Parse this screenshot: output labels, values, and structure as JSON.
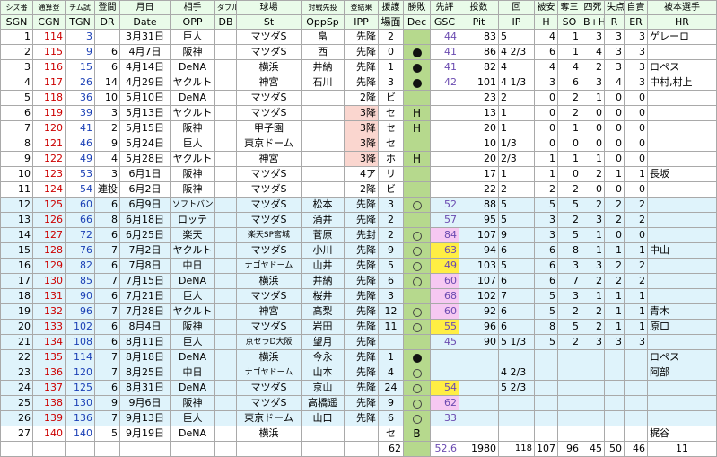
{
  "headers_top": [
    "シズ番",
    "通算登",
    "チム試",
    "登間",
    "月日",
    "相手",
    "ダブル",
    "球場",
    "対戦先投",
    "登結果",
    "援護",
    "勝敗",
    "先評",
    "投数",
    "回",
    "被安",
    "奪三",
    "四死",
    "失点",
    "自責",
    "被本選手"
  ],
  "headers": [
    "SGN",
    "CGN",
    "TGN",
    "DR",
    "Date",
    "OPP",
    "DB",
    "St",
    "OppSp",
    "IPP",
    "場面",
    "Dec",
    "GSC",
    "Pit",
    "IP",
    "H",
    "SO",
    "B+H",
    "R",
    "ER",
    "HR"
  ],
  "rows": [
    {
      "sgn": "1",
      "cgn": "114",
      "tgn": "3",
      "dr": "",
      "date": "3月31日",
      "opp": "巨人",
      "db": "",
      "st": "マツダS",
      "oppsp": "畠",
      "ipp": "先降",
      "sup": "2",
      "dec": "",
      "gsc": "44",
      "pit": "83",
      "ip": "5",
      "h": "4",
      "so": "1",
      "bh": "3",
      "r": "3",
      "er": "3",
      "hr": "ゲレーロ",
      "bg": "white",
      "decType": "none",
      "gscColor": "",
      "resPink": false
    },
    {
      "sgn": "2",
      "cgn": "115",
      "tgn": "9",
      "dr": "6",
      "date": "4月7日",
      "opp": "阪神",
      "db": "",
      "st": "マツダS",
      "oppsp": "西",
      "ipp": "先降",
      "sup": "0",
      "dec": "●",
      "gsc": "41",
      "pit": "86",
      "ip": "4 2/3",
      "h": "6",
      "so": "1",
      "bh": "4",
      "r": "3",
      "er": "3",
      "hr": "",
      "bg": "white",
      "decType": "filled",
      "gscColor": "",
      "resPink": false
    },
    {
      "sgn": "3",
      "cgn": "116",
      "tgn": "15",
      "dr": "6",
      "date": "4月14日",
      "opp": "DeNA",
      "db": "",
      "st": "横浜",
      "oppsp": "井納",
      "ipp": "先降",
      "sup": "1",
      "dec": "●",
      "gsc": "41",
      "pit": "82",
      "ip": "4",
      "h": "4",
      "so": "4",
      "bh": "2",
      "r": "3",
      "er": "3",
      "hr": "ロペス",
      "bg": "white",
      "decType": "filled",
      "gscColor": "",
      "resPink": false
    },
    {
      "sgn": "4",
      "cgn": "117",
      "tgn": "26",
      "dr": "14",
      "date": "4月29日",
      "opp": "ヤクルト",
      "db": "",
      "st": "神宮",
      "oppsp": "石川",
      "ipp": "先降",
      "sup": "3",
      "dec": "●",
      "gsc": "42",
      "pit": "101",
      "ip": "4 1/3",
      "h": "3",
      "so": "6",
      "bh": "3",
      "r": "4",
      "er": "3",
      "hr": "中村,村上",
      "bg": "white",
      "decType": "filled",
      "gscColor": "",
      "resPink": false
    },
    {
      "sgn": "5",
      "cgn": "118",
      "tgn": "36",
      "dr": "10",
      "date": "5月10日",
      "opp": "DeNA",
      "db": "",
      "st": "マツダS",
      "oppsp": "",
      "ipp": "2降",
      "sup": "ビ",
      "dec": "",
      "gsc": "",
      "pit": "23",
      "ip": "2",
      "h": "0",
      "so": "2",
      "bh": "1",
      "r": "0",
      "er": "0",
      "hr": "",
      "bg": "white",
      "decType": "none",
      "gscColor": "",
      "resPink": false
    },
    {
      "sgn": "6",
      "cgn": "119",
      "tgn": "39",
      "dr": "3",
      "date": "5月13日",
      "opp": "ヤクルト",
      "db": "",
      "st": "マツダS",
      "oppsp": "",
      "ipp": "3降",
      "sup": "セ",
      "dec": "H",
      "gsc": "",
      "pit": "13",
      "ip": "1",
      "h": "0",
      "so": "2",
      "bh": "0",
      "r": "0",
      "er": "0",
      "hr": "",
      "bg": "white",
      "decType": "text",
      "gscColor": "",
      "resPink": true
    },
    {
      "sgn": "7",
      "cgn": "120",
      "tgn": "41",
      "dr": "2",
      "date": "5月15日",
      "opp": "阪神",
      "db": "",
      "st": "甲子園",
      "oppsp": "",
      "ipp": "3降",
      "sup": "セ",
      "dec": "H",
      "gsc": "",
      "pit": "20",
      "ip": "1",
      "h": "0",
      "so": "1",
      "bh": "0",
      "r": "0",
      "er": "0",
      "hr": "",
      "bg": "white",
      "decType": "text",
      "gscColor": "",
      "resPink": true
    },
    {
      "sgn": "8",
      "cgn": "121",
      "tgn": "46",
      "dr": "9",
      "date": "5月24日",
      "opp": "巨人",
      "db": "",
      "st": "東京ドーム",
      "oppsp": "",
      "ipp": "3降",
      "sup": "セ",
      "dec": "",
      "gsc": "",
      "pit": "10",
      "ip": "1/3",
      "h": "0",
      "so": "0",
      "bh": "0",
      "r": "0",
      "er": "0",
      "hr": "",
      "bg": "white",
      "decType": "none",
      "gscColor": "",
      "resPink": true
    },
    {
      "sgn": "9",
      "cgn": "122",
      "tgn": "49",
      "dr": "4",
      "date": "5月28日",
      "opp": "ヤクルト",
      "db": "",
      "st": "神宮",
      "oppsp": "",
      "ipp": "3降",
      "sup": "ホ",
      "dec": "H",
      "gsc": "",
      "pit": "20",
      "ip": "2/3",
      "h": "1",
      "so": "1",
      "bh": "1",
      "r": "0",
      "er": "0",
      "hr": "",
      "bg": "white",
      "decType": "text",
      "gscColor": "",
      "resPink": true
    },
    {
      "sgn": "10",
      "cgn": "123",
      "tgn": "53",
      "dr": "3",
      "date": "6月1日",
      "opp": "阪神",
      "db": "",
      "st": "マツダS",
      "oppsp": "",
      "ipp": "4ア",
      "sup": "リ",
      "dec": "",
      "gsc": "",
      "pit": "17",
      "ip": "1",
      "h": "1",
      "so": "0",
      "bh": "2",
      "r": "1",
      "er": "1",
      "hr": "長坂",
      "bg": "white",
      "decType": "none",
      "gscColor": "",
      "resPink": false
    },
    {
      "sgn": "11",
      "cgn": "124",
      "tgn": "54",
      "dr": "連投",
      "date": "6月2日",
      "opp": "阪神",
      "db": "",
      "st": "マツダS",
      "oppsp": "",
      "ipp": "2降",
      "sup": "ビ",
      "dec": "",
      "gsc": "",
      "pit": "22",
      "ip": "2",
      "h": "2",
      "so": "2",
      "bh": "0",
      "r": "0",
      "er": "0",
      "hr": "",
      "bg": "white",
      "decType": "none",
      "gscColor": "",
      "resPink": false
    },
    {
      "sgn": "12",
      "cgn": "125",
      "tgn": "60",
      "dr": "6",
      "date": "6月9日",
      "opp": "ソフトバンク",
      "db": "",
      "st": "マツダS",
      "oppsp": "松本",
      "ipp": "先降",
      "sup": "3",
      "dec": "○",
      "gsc": "52",
      "pit": "88",
      "ip": "5",
      "h": "5",
      "so": "5",
      "bh": "2",
      "r": "2",
      "er": "2",
      "hr": "",
      "bg": "blue",
      "decType": "open",
      "gscColor": "",
      "resPink": false
    },
    {
      "sgn": "13",
      "cgn": "126",
      "tgn": "66",
      "dr": "8",
      "date": "6月18日",
      "opp": "ロッテ",
      "db": "",
      "st": "マツダS",
      "oppsp": "涌井",
      "ipp": "先降",
      "sup": "2",
      "dec": "",
      "gsc": "57",
      "pit": "95",
      "ip": "5",
      "h": "3",
      "so": "2",
      "bh": "3",
      "r": "2",
      "er": "2",
      "hr": "",
      "bg": "blue",
      "decType": "none",
      "gscColor": "",
      "resPink": false
    },
    {
      "sgn": "14",
      "cgn": "127",
      "tgn": "72",
      "dr": "6",
      "date": "6月25日",
      "opp": "楽天",
      "db": "",
      "st": "楽天SP宮城",
      "oppsp": "菅原",
      "ipp": "先封",
      "sup": "2",
      "dec": "○",
      "gsc": "84",
      "pit": "107",
      "ip": "9",
      "h": "3",
      "so": "5",
      "bh": "1",
      "r": "0",
      "er": "0",
      "hr": "",
      "bg": "blue",
      "decType": "open",
      "gscColor": "pink",
      "resPink": false
    },
    {
      "sgn": "15",
      "cgn": "128",
      "tgn": "76",
      "dr": "7",
      "date": "7月2日",
      "opp": "ヤクルト",
      "db": "",
      "st": "マツダS",
      "oppsp": "小川",
      "ipp": "先降",
      "sup": "9",
      "dec": "○",
      "gsc": "63",
      "pit": "94",
      "ip": "6",
      "h": "6",
      "so": "8",
      "bh": "1",
      "r": "1",
      "er": "1",
      "hr": "中山",
      "bg": "blue",
      "decType": "open",
      "gscColor": "yellow",
      "resPink": false
    },
    {
      "sgn": "16",
      "cgn": "129",
      "tgn": "82",
      "dr": "6",
      "date": "7月8日",
      "opp": "中日",
      "db": "",
      "st": "ナゴヤドーム",
      "oppsp": "山井",
      "ipp": "先降",
      "sup": "5",
      "dec": "○",
      "gsc": "49",
      "pit": "103",
      "ip": "5",
      "h": "6",
      "so": "3",
      "bh": "3",
      "r": "2",
      "er": "2",
      "hr": "",
      "bg": "blue",
      "decType": "open",
      "gscColor": "yellow",
      "resPink": false
    },
    {
      "sgn": "17",
      "cgn": "130",
      "tgn": "85",
      "dr": "7",
      "date": "7月15日",
      "opp": "DeNA",
      "db": "",
      "st": "横浜",
      "oppsp": "井納",
      "ipp": "先降",
      "sup": "6",
      "dec": "○",
      "gsc": "60",
      "pit": "107",
      "ip": "6",
      "h": "6",
      "so": "7",
      "bh": "2",
      "r": "2",
      "er": "2",
      "hr": "",
      "bg": "blue",
      "decType": "open",
      "gscColor": "pink",
      "resPink": false
    },
    {
      "sgn": "18",
      "cgn": "131",
      "tgn": "90",
      "dr": "6",
      "date": "7月21日",
      "opp": "巨人",
      "db": "",
      "st": "マツダS",
      "oppsp": "桜井",
      "ipp": "先降",
      "sup": "3",
      "dec": "",
      "gsc": "68",
      "pit": "102",
      "ip": "7",
      "h": "5",
      "so": "3",
      "bh": "1",
      "r": "1",
      "er": "1",
      "hr": "",
      "bg": "blue",
      "decType": "none",
      "gscColor": "pink",
      "resPink": false
    },
    {
      "sgn": "19",
      "cgn": "132",
      "tgn": "96",
      "dr": "7",
      "date": "7月28日",
      "opp": "ヤクルト",
      "db": "",
      "st": "神宮",
      "oppsp": "高梨",
      "ipp": "先降",
      "sup": "12",
      "dec": "○",
      "gsc": "60",
      "pit": "92",
      "ip": "6",
      "h": "5",
      "so": "2",
      "bh": "2",
      "r": "1",
      "er": "1",
      "hr": "青木",
      "bg": "blue",
      "decType": "open",
      "gscColor": "pink",
      "resPink": false
    },
    {
      "sgn": "20",
      "cgn": "133",
      "tgn": "102",
      "dr": "6",
      "date": "8月4日",
      "opp": "阪神",
      "db": "",
      "st": "マツダS",
      "oppsp": "岩田",
      "ipp": "先降",
      "sup": "11",
      "dec": "○",
      "gsc": "55",
      "pit": "96",
      "ip": "6",
      "h": "8",
      "so": "5",
      "bh": "2",
      "r": "1",
      "er": "1",
      "hr": "原口",
      "bg": "blue",
      "decType": "open",
      "gscColor": "yellow",
      "resPink": false
    },
    {
      "sgn": "21",
      "cgn": "134",
      "tgn": "108",
      "dr": "6",
      "date": "8月11日",
      "opp": "巨人",
      "db": "",
      "st": "京セラD大阪",
      "oppsp": "望月",
      "ipp": "先降",
      "sup": "",
      "dec": "",
      "gsc": "45",
      "pit": "90",
      "ip": "5 1/3",
      "h": "5",
      "so": "2",
      "bh": "3",
      "r": "3",
      "er": "3",
      "hr": "",
      "bg": "blue",
      "decType": "none",
      "gscColor": "",
      "resPink": false
    },
    {
      "sgn": "22",
      "cgn": "135",
      "tgn": "114",
      "dr": "7",
      "date": "8月18日",
      "opp": "DeNA",
      "db": "",
      "st": "横浜",
      "oppsp": "今永",
      "ipp": "先降",
      "sup": "1",
      "dec": "●",
      "gsc": "",
      "pit": "",
      "ip": "",
      "h": "",
      "so": "",
      "bh": "",
      "r": "",
      "er": "",
      "hr": "ロペス",
      "bg": "blue",
      "decType": "filled",
      "gscColor": "",
      "resPink": false
    },
    {
      "sgn": "23",
      "cgn": "136",
      "tgn": "120",
      "dr": "7",
      "date": "8月25日",
      "opp": "中日",
      "db": "",
      "st": "ナゴヤドーム",
      "oppsp": "山本",
      "ipp": "先降",
      "sup": "4",
      "dec": "○",
      "gsc": "",
      "pit": "",
      "ip": "4 2/3",
      "h": "",
      "so": "",
      "bh": "",
      "r": "",
      "er": "",
      "hr": "阿部",
      "bg": "blue",
      "decType": "open",
      "gscColor": "",
      "resPink": false
    },
    {
      "sgn": "24",
      "cgn": "137",
      "tgn": "125",
      "dr": "6",
      "date": "8月31日",
      "opp": "DeNA",
      "db": "",
      "st": "マツダS",
      "oppsp": "京山",
      "ipp": "先降",
      "sup": "24",
      "dec": "○",
      "gsc": "54",
      "pit": "",
      "ip": "5 2/3",
      "h": "",
      "so": "",
      "bh": "",
      "r": "",
      "er": "",
      "hr": "",
      "bg": "blue",
      "decType": "open",
      "gscColor": "yellow",
      "resPink": false
    },
    {
      "sgn": "25",
      "cgn": "138",
      "tgn": "130",
      "dr": "9",
      "date": "9月6日",
      "opp": "阪神",
      "db": "",
      "st": "マツダS",
      "oppsp": "高橋遥",
      "ipp": "先降",
      "sup": "9",
      "dec": "○",
      "gsc": "62",
      "pit": "",
      "ip": "",
      "h": "",
      "so": "",
      "bh": "",
      "r": "",
      "er": "",
      "hr": "",
      "bg": "blue",
      "decType": "open",
      "gscColor": "pink",
      "resPink": false
    },
    {
      "sgn": "26",
      "cgn": "139",
      "tgn": "136",
      "dr": "7",
      "date": "9月13日",
      "opp": "巨人",
      "db": "",
      "st": "東京ドーム",
      "oppsp": "山口",
      "ipp": "先降",
      "sup": "6",
      "dec": "○",
      "gsc": "33",
      "pit": "",
      "ip": "",
      "h": "",
      "so": "",
      "bh": "",
      "r": "",
      "er": "",
      "hr": "",
      "bg": "blue",
      "decType": "open",
      "gscColor": "",
      "resPink": false
    },
    {
      "sgn": "27",
      "cgn": "140",
      "tgn": "140",
      "dr": "5",
      "date": "9月19日",
      "opp": "DeNA",
      "db": "",
      "st": "横浜",
      "oppsp": "",
      "ipp": "",
      "sup": "セ",
      "dec": "B",
      "gsc": "",
      "pit": "",
      "ip": "",
      "h": "",
      "so": "",
      "bh": "",
      "r": "",
      "er": "",
      "hr": "梶谷",
      "bg": "white",
      "decType": "text",
      "gscColor": "",
      "resPink": false
    }
  ],
  "totals": {
    "sup": "62",
    "gsc": "52.6",
    "pit": "1980",
    "ip": "118",
    "h": "107",
    "so": "96",
    "bh": "45",
    "r": "50",
    "er": "46",
    "hr": "11"
  }
}
